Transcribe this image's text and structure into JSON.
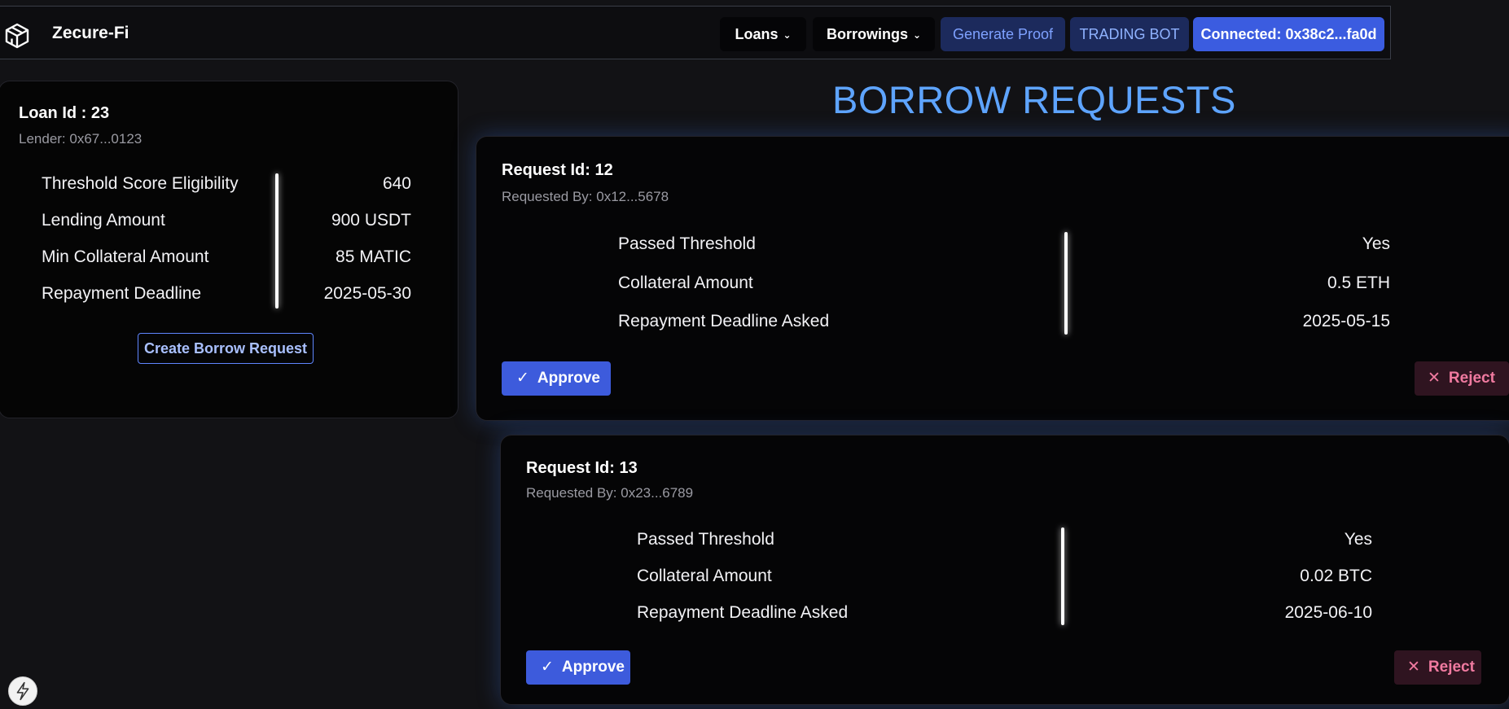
{
  "brand": {
    "name": "Zecure-Fi",
    "logo_icon": "cube-logo-icon"
  },
  "nav": {
    "loans": "Loans",
    "borrowings": "Borrowings",
    "generate_proof": "Generate Proof",
    "trading_bot": "TRADING BOT",
    "connected": "Connected: 0x38c2...fa0d"
  },
  "loan": {
    "title": "Loan Id : 23",
    "lender": "Lender: 0x67...0123",
    "rows": [
      {
        "label": "Threshold Score Eligibility",
        "value": "640"
      },
      {
        "label": "Lending Amount",
        "value": "900 USDT"
      },
      {
        "label": "Min Collateral Amount",
        "value": "85 MATIC"
      },
      {
        "label": "Repayment Deadline",
        "value": "2025-05-30"
      }
    ],
    "create_button": "Create Borrow Request"
  },
  "heading": "BORROW REQUESTS",
  "requests": [
    {
      "title": "Request Id: 12",
      "requested_by": "Requested By: 0x12...5678",
      "rows": [
        {
          "label": "Passed Threshold",
          "value": "Yes"
        },
        {
          "label": "Collateral Amount",
          "value": "0.5 ETH"
        },
        {
          "label": "Repayment Deadline Asked",
          "value": "2025-05-15"
        }
      ],
      "approve": "Approve",
      "reject": "Reject"
    },
    {
      "title": "Request Id: 13",
      "requested_by": "Requested By: 0x23...6789",
      "rows": [
        {
          "label": "Passed Threshold",
          "value": "Yes"
        },
        {
          "label": "Collateral Amount",
          "value": "0.02 BTC"
        },
        {
          "label": "Repayment Deadline Asked",
          "value": "2025-06-10"
        }
      ],
      "approve": "Approve",
      "reject": "Reject"
    }
  ],
  "colors": {
    "background": "#121215",
    "accent_blue": "#3b5ce0",
    "heading_blue": "#5ea4ff",
    "reject_pink": "#f07aa0"
  }
}
